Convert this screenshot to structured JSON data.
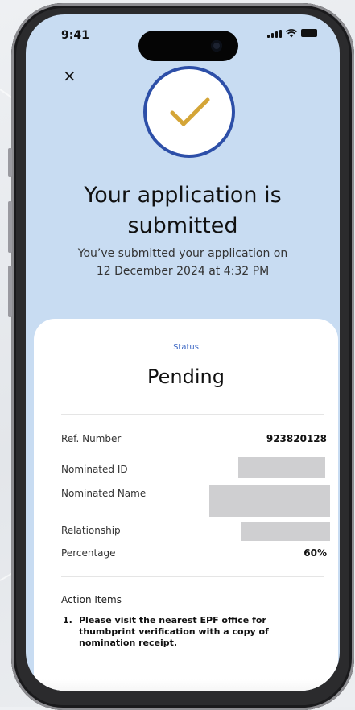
{
  "status_bar": {
    "time": "9:41"
  },
  "header": {
    "close_symbol": "×",
    "title_line1": "Your application is",
    "title_line2": "submitted",
    "subtitle_line1": "You’ve submitted your application on",
    "subtitle_line2": "12 December 2024 at 4:32 PM"
  },
  "status": {
    "label": "Status",
    "value": "Pending"
  },
  "details": [
    {
      "label": "Ref. Number",
      "value": "923820128",
      "redacted": false
    },
    {
      "label": "Nominated ID",
      "value": "",
      "redacted": true
    },
    {
      "label": "Nominated Name",
      "value": "",
      "redacted": true
    },
    {
      "label": "Relationship",
      "value": "",
      "redacted": true
    },
    {
      "label": "Percentage",
      "value": "60%",
      "redacted": false
    }
  ],
  "action_items": {
    "title": "Action Items",
    "items": [
      {
        "number": "1.",
        "text": "Please visit the nearest EPF office for thumbprint verification with a copy of nomination receipt."
      }
    ]
  },
  "icons": [
    "close-icon",
    "checkmark-icon",
    "signal-icon",
    "wifi-icon",
    "battery-icon"
  ],
  "colors": {
    "header_background": "#c8dcf2",
    "check_ring": "#2d4fa8",
    "checkmark": "#d4a537",
    "status_label": "#3c67c4",
    "redaction": "#cfcfd1"
  }
}
